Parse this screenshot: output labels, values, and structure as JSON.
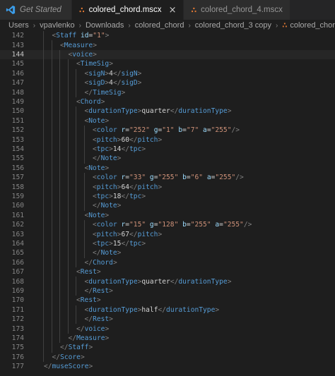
{
  "tabs": [
    {
      "label": "Get Started",
      "icon": "vscode-icon",
      "active": false,
      "italic": true
    },
    {
      "label": "colored_chord.mscx",
      "icon": "xml-icon",
      "active": true,
      "close": "×"
    },
    {
      "label": "colored_chord_4.mscx",
      "icon": "xml-icon",
      "active": false
    }
  ],
  "breadcrumb": [
    "Users",
    "vpavlenko",
    "Downloads",
    "colored_chord",
    "colored_chord_3 copy",
    "colored_chord.mscx"
  ],
  "current_line": 144,
  "colors": {
    "tag": "#569cd6",
    "attr": "#9cdcfe",
    "string": "#ce9178",
    "text": "#d4d4d4",
    "punct": "#808080",
    "accent_icon": "#3b9ce8",
    "xml_icon": "#e37933"
  },
  "lines": [
    {
      "n": "142",
      "i": 1,
      "c": "<Staff id=\"1\">"
    },
    {
      "n": "143",
      "i": 2,
      "c": "<Measure>"
    },
    {
      "n": "144",
      "i": 3,
      "c": "<voice>"
    },
    {
      "n": "145",
      "i": 4,
      "c": "<TimeSig>"
    },
    {
      "n": "146",
      "i": 5,
      "c": "<sigN>4</sigN>"
    },
    {
      "n": "147",
      "i": 5,
      "c": "<sigD>4</sigD>"
    },
    {
      "n": "148",
      "i": 5,
      "c": "</TimeSig>"
    },
    {
      "n": "149",
      "i": 4,
      "c": "<Chord>"
    },
    {
      "n": "150",
      "i": 5,
      "c": "<durationType>quarter</durationType>"
    },
    {
      "n": "151",
      "i": 5,
      "c": "<Note>"
    },
    {
      "n": "152",
      "i": 6,
      "c": "<color r=\"252\" g=\"1\" b=\"7\" a=\"255\"/>"
    },
    {
      "n": "153",
      "i": 6,
      "c": "<pitch>60</pitch>"
    },
    {
      "n": "154",
      "i": 6,
      "c": "<tpc>14</tpc>"
    },
    {
      "n": "155",
      "i": 6,
      "c": "</Note>"
    },
    {
      "n": "156",
      "i": 5,
      "c": "<Note>"
    },
    {
      "n": "157",
      "i": 6,
      "c": "<color r=\"33\" g=\"255\" b=\"6\" a=\"255\"/>"
    },
    {
      "n": "158",
      "i": 6,
      "c": "<pitch>64</pitch>"
    },
    {
      "n": "159",
      "i": 6,
      "c": "<tpc>18</tpc>"
    },
    {
      "n": "160",
      "i": 6,
      "c": "</Note>"
    },
    {
      "n": "161",
      "i": 5,
      "c": "<Note>"
    },
    {
      "n": "162",
      "i": 6,
      "c": "<color r=\"15\" g=\"128\" b=\"255\" a=\"255\"/>"
    },
    {
      "n": "163",
      "i": 6,
      "c": "<pitch>67</pitch>"
    },
    {
      "n": "164",
      "i": 6,
      "c": "<tpc>15</tpc>"
    },
    {
      "n": "165",
      "i": 6,
      "c": "</Note>"
    },
    {
      "n": "166",
      "i": 5,
      "c": "</Chord>"
    },
    {
      "n": "167",
      "i": 4,
      "c": "<Rest>"
    },
    {
      "n": "168",
      "i": 5,
      "c": "<durationType>quarter</durationType>"
    },
    {
      "n": "169",
      "i": 5,
      "c": "</Rest>"
    },
    {
      "n": "170",
      "i": 4,
      "c": "<Rest>"
    },
    {
      "n": "171",
      "i": 5,
      "c": "<durationType>half</durationType>"
    },
    {
      "n": "172",
      "i": 5,
      "c": "</Rest>"
    },
    {
      "n": "173",
      "i": 4,
      "c": "</voice>"
    },
    {
      "n": "174",
      "i": 3,
      "c": "</Measure>"
    },
    {
      "n": "175",
      "i": 2,
      "c": "</Staff>"
    },
    {
      "n": "176",
      "i": 1,
      "c": "</Score>"
    },
    {
      "n": "177",
      "i": 0,
      "c": "</museScore>"
    }
  ]
}
